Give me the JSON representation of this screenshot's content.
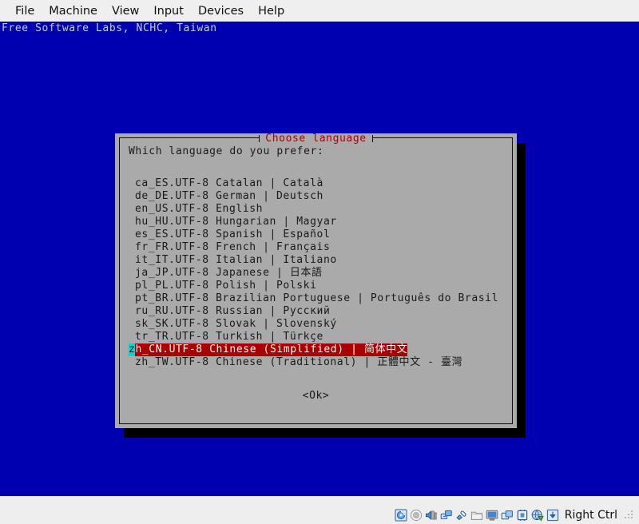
{
  "window": {
    "menubar": [
      {
        "label": "File",
        "name": "menu-file"
      },
      {
        "label": "Machine",
        "name": "menu-machine"
      },
      {
        "label": "View",
        "name": "menu-view"
      },
      {
        "label": "Input",
        "name": "menu-input"
      },
      {
        "label": "Devices",
        "name": "menu-devices"
      },
      {
        "label": "Help",
        "name": "menu-help"
      }
    ]
  },
  "console": {
    "banner": "Free Software Labs, NCHC, Taiwan",
    "background_color": "#0000b0",
    "text_color": "#c8c8d8"
  },
  "dialog": {
    "title": "Choose language",
    "title_color": "#aa0000",
    "background_color": "#aaaaaa",
    "prompt": "Which language do you prefer:",
    "ok_label": "<Ok>",
    "selection_background": "#aa0000",
    "cursor_background": "#00d8d8",
    "cursor_char": "z",
    "languages": [
      {
        "text": "ca_ES.UTF-8 Catalan | Català",
        "selected": false
      },
      {
        "text": "de_DE.UTF-8 German | Deutsch",
        "selected": false
      },
      {
        "text": "en_US.UTF-8 English",
        "selected": false
      },
      {
        "text": "hu_HU.UTF-8 Hungarian | Magyar",
        "selected": false
      },
      {
        "text": "es_ES.UTF-8 Spanish | Español",
        "selected": false
      },
      {
        "text": "fr_FR.UTF-8 French | Français",
        "selected": false
      },
      {
        "text": "it_IT.UTF-8 Italian | Italiano",
        "selected": false
      },
      {
        "text": "ja_JP.UTF-8 Japanese | 日本語",
        "selected": false
      },
      {
        "text": "pl_PL.UTF-8 Polish | Polski",
        "selected": false
      },
      {
        "text": "pt_BR.UTF-8 Brazilian Portuguese | Português do Brasil",
        "selected": false
      },
      {
        "text": "ru_RU.UTF-8 Russian | Русский",
        "selected": false
      },
      {
        "text": "sk_SK.UTF-8 Slovak | Slovenský",
        "selected": false
      },
      {
        "text": "tr_TR.UTF-8 Turkish | Türkçe",
        "selected": false
      },
      {
        "text": "zh_CN.UTF-8 Chinese (Simplified) | 简体中文",
        "selected": true,
        "head": "z",
        "tail": "h_CN.UTF-8 Chinese (Simplified) | 简体中文"
      },
      {
        "text": "zh_TW.UTF-8 Chinese (Traditional) | 正體中文 - 臺灣",
        "selected": false
      }
    ]
  },
  "statusbar": {
    "icons": [
      {
        "name": "hard-disk-icon"
      },
      {
        "name": "optical-disk-icon"
      },
      {
        "name": "audio-icon"
      },
      {
        "name": "network-icon"
      },
      {
        "name": "usb-icon"
      },
      {
        "name": "shared-folder-icon"
      },
      {
        "name": "display-icon"
      },
      {
        "name": "recording-icon"
      },
      {
        "name": "processor-icon"
      },
      {
        "name": "remote-globe-icon"
      },
      {
        "name": "host-key-icon"
      }
    ],
    "host_key_label": "Right Ctrl"
  }
}
